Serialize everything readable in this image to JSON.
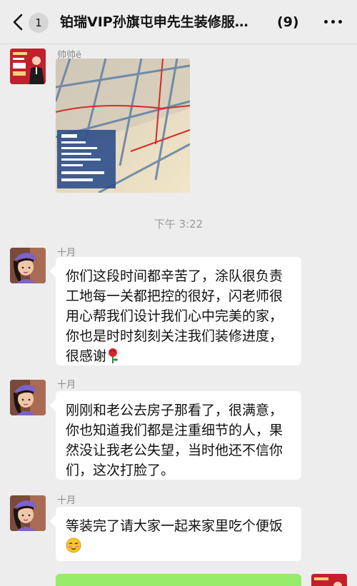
{
  "header": {
    "back_badge": "1",
    "title": "铂瑞VIP孙旗屯申先生装修服…",
    "member_count": "(9)"
  },
  "time_divider": "下午 3:22",
  "messages": [
    {
      "sender": "帅帅ë",
      "type": "image"
    },
    {
      "sender": "十月",
      "text": "你们这段时间都辛苦了，涂队很负责工地每一关都把控的很好，闪老师很用心帮我们设计我们心中完美的家，你也是时时刻刻关注我们装修进度，很感谢",
      "emoji": "rose"
    },
    {
      "sender": "十月",
      "text": "刚刚和老公去房子那看了，很满意，你也知道我们都是注重细节的人，果然没让我老公失望，当时他还不信你们，这次打脸了。"
    },
    {
      "sender": "十月",
      "text": "等装完了请大家一起来家里吃个便饭",
      "emoji": "blush-face"
    }
  ]
}
